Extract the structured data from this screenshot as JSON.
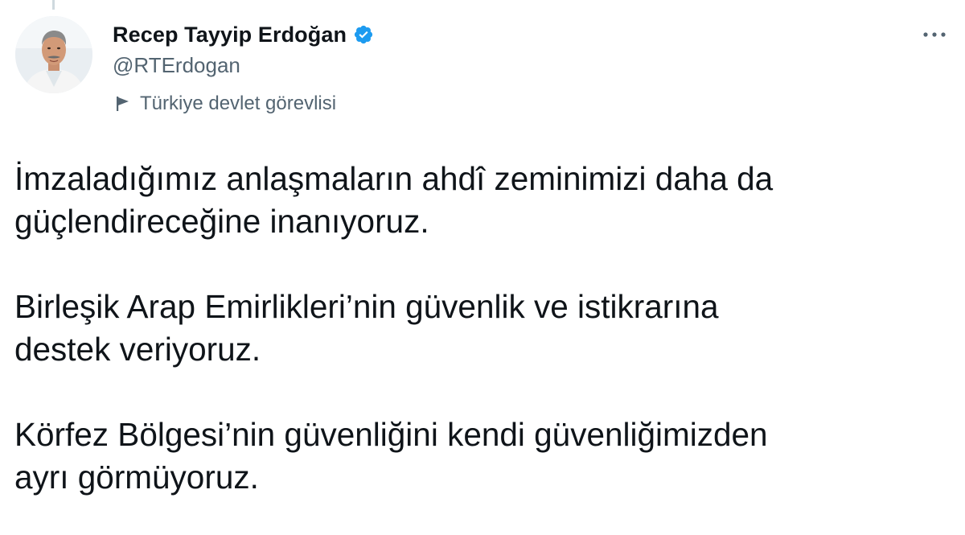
{
  "author": {
    "display_name": "Recep Tayyip Erdoğan",
    "handle": "@RTErdogan",
    "verified": true,
    "verified_icon": "verified-badge-icon",
    "account_label": "Türkiye devlet görevlisi",
    "account_label_icon": "flag-icon"
  },
  "menu": {
    "more_icon": "more-horizontal-icon"
  },
  "tweet": {
    "paragraphs": [
      "İmzaladığımız anlaşmaların ahdî zeminimizi daha da\ngüçlendireceğine inanıyoruz.",
      "Birleşik Arap Emirlikleri’nin güvenlik ve istikrarına\ndestek veriyoruz.",
      "Körfez Bölgesi’nin güvenliğini kendi güvenliğimizden\nayrı görmüyoruz."
    ]
  },
  "colors": {
    "text_primary": "#0f1419",
    "text_secondary": "#536471",
    "verified_blue": "#1d9bf0",
    "background": "#ffffff"
  }
}
